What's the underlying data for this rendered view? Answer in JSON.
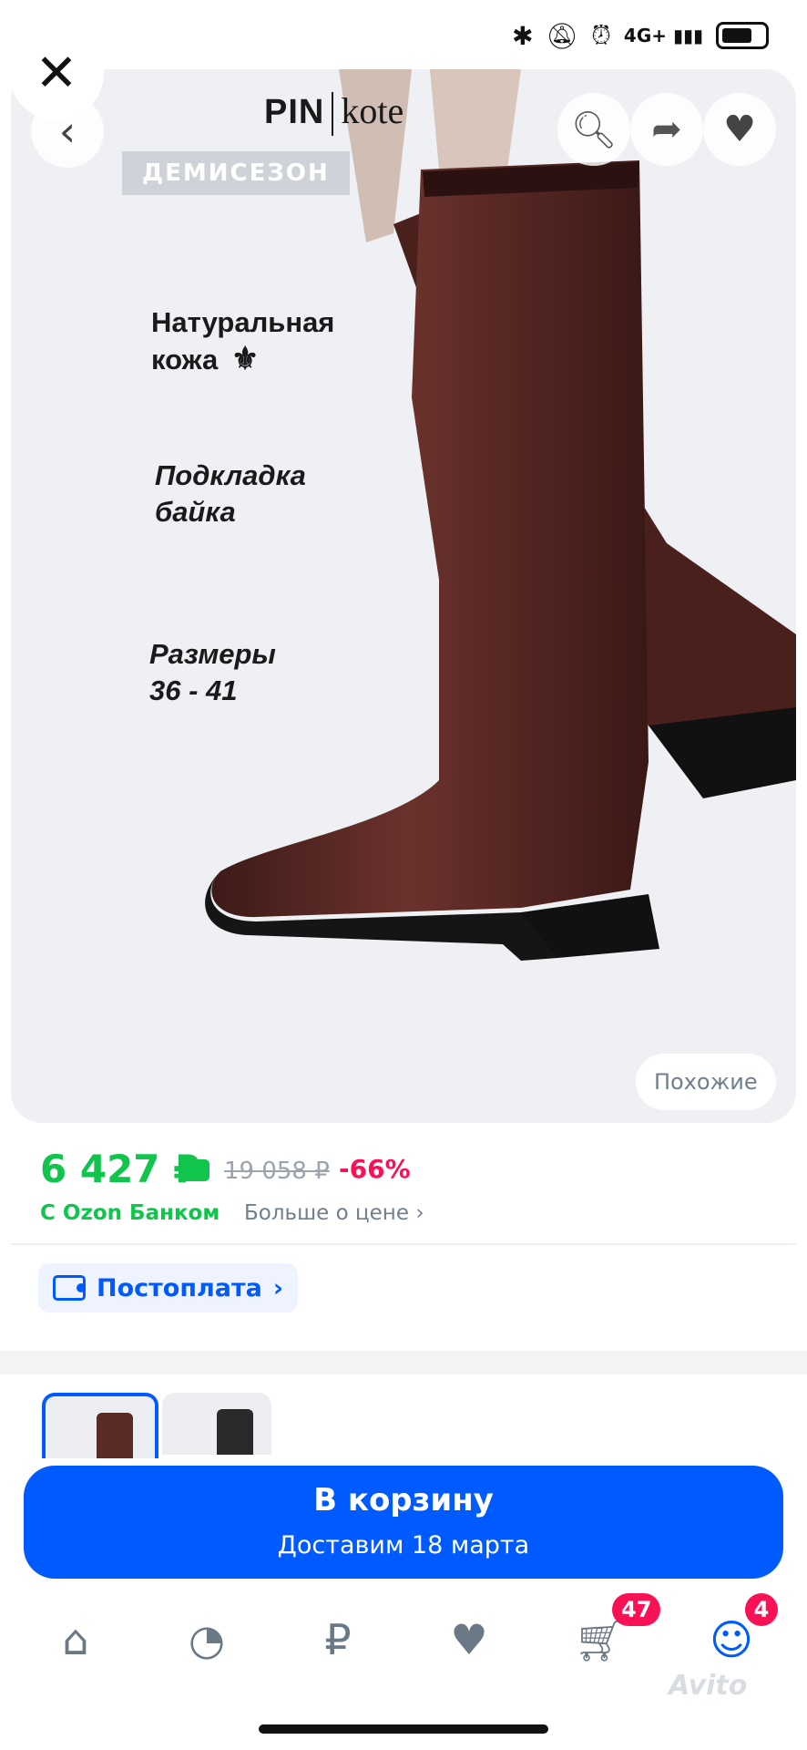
{
  "status_bar": {
    "time": "",
    "icons": [
      "bluetooth-icon",
      "mute-icon",
      "alarm-icon",
      "signal-icon",
      "battery-icon"
    ],
    "network": "4G+"
  },
  "gallery": {
    "brand_left": "PIN",
    "brand_right": "kote",
    "season_badge": "ДЕМИСЕЗОН",
    "features": {
      "leather": "Натуральная кожа",
      "lining": "Подкладка байка",
      "sizes": "Размеры 36 - 41"
    },
    "similar_button": "Похожие"
  },
  "price": {
    "current": "6 427 ₽",
    "old": "19 058 ₽",
    "discount": "-66%",
    "bank_label": "С Ozon Банком",
    "more_label": "Больше о цене",
    "postpay_label": "Постоплата"
  },
  "cart_button": {
    "title": "В корзину",
    "subtitle": "Доставим 18 марта"
  },
  "nav": {
    "items": [
      "home-icon",
      "catalog-icon",
      "finance-icon",
      "favorites-icon",
      "cart-icon",
      "profile-icon"
    ],
    "cart_badge": "47",
    "profile_badge": "4"
  },
  "watermark": "Avito",
  "colors": {
    "accent": "#005bff",
    "price_green": "#10c44c",
    "discount_pink": "#f91155",
    "boot_brown": "#5a2a26"
  }
}
